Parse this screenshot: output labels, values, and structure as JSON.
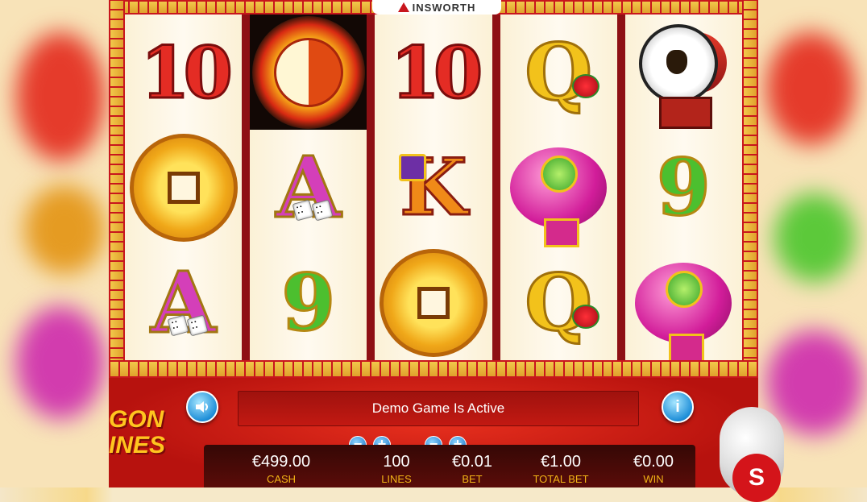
{
  "logo": {
    "text": "INSWORTH"
  },
  "reels": [
    [
      "10",
      "coin",
      "A"
    ],
    [
      "yinyang",
      "A",
      "9"
    ],
    [
      "10",
      "K",
      "coin"
    ],
    [
      "Q",
      "lantern",
      "Q"
    ],
    [
      "drum",
      "9",
      "lantern"
    ]
  ],
  "message": "Demo Game Is Active",
  "brand": {
    "line1": "GON",
    "line2": "INES"
  },
  "stats": [
    {
      "value": "€499.00",
      "label": "CASH"
    },
    {
      "value": "100",
      "label": "LINES"
    },
    {
      "value": "€0.01",
      "label": "BET"
    },
    {
      "value": "€1.00",
      "label": "TOTAL BET"
    },
    {
      "value": "€0.00",
      "label": "WIN"
    }
  ],
  "buttons": {
    "minus": "−",
    "plus": "+",
    "info": "i",
    "spin": "S"
  },
  "icons": {
    "sound": "speaker-icon",
    "info": "info-icon"
  },
  "colors": {
    "accent_red": "#c8161d",
    "gold": "#f2c21b",
    "button_blue": "#1f8fd8"
  }
}
